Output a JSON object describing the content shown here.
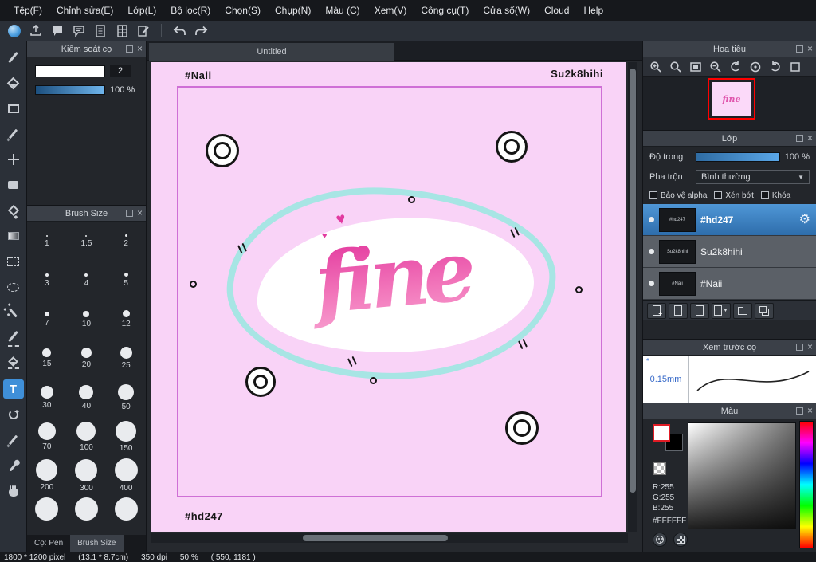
{
  "menubar": {
    "items": [
      "Tệp(F)",
      "Chỉnh sửa(E)",
      "Lớp(L)",
      "Bộ lọc(R)",
      "Chọn(S)",
      "Chụp(N)",
      "Màu (C)",
      "Xem(V)",
      "Công cụ(T)",
      "Cửa sổ(W)",
      "Cloud",
      "Help"
    ]
  },
  "canvas": {
    "tab_title": "Untitled",
    "top_left": "#Naii",
    "top_right": "Su2k8hihi",
    "bottom_left": "#hd247",
    "word": "fine"
  },
  "left": {
    "brush_control": {
      "title": "Kiểm soát cọ",
      "width_value": "2",
      "opacity_value": "100 %"
    },
    "brush_size": {
      "title": "Brush Size",
      "sizes": [
        "1",
        "1.5",
        "2",
        "3",
        "4",
        "5",
        "7",
        "10",
        "12",
        "15",
        "20",
        "25",
        "30",
        "40",
        "50",
        "70",
        "100",
        "150",
        "200",
        "300",
        "400",
        "",
        "",
        ""
      ]
    },
    "tabs": {
      "pen": "Cọ: Pen",
      "size": "Brush Size"
    }
  },
  "right": {
    "navigator": {
      "title": "Hoa tiêu"
    },
    "layers": {
      "title": "Lớp",
      "opacity_label": "Độ trong",
      "opacity_value": "100 %",
      "blend_label": "Pha trộn",
      "blend_value": "Bình thường",
      "checkboxes": [
        "Bảo vệ alpha",
        "Xén bớt",
        "Khóa"
      ],
      "items": [
        {
          "name": "#hd247",
          "selected": true
        },
        {
          "name": "Su2k8hihi",
          "selected": false
        },
        {
          "name": "#Naii",
          "selected": false
        }
      ]
    },
    "brush_preview": {
      "title": "Xem trước cọ",
      "size": "0.15mm"
    },
    "color": {
      "title": "Màu",
      "r": "R:255",
      "g": "G:255",
      "b": "B:255",
      "hex": "#FFFFFF"
    }
  },
  "statusbar": {
    "dimensions": "1800 * 1200 pixel",
    "cm": "(13.1 * 8.7cm)",
    "dpi": "350 dpi",
    "zoom": "50 %",
    "coords": "( 550, 1181 )"
  },
  "icons": {
    "close": "×",
    "dropdown": "▼",
    "gear": "⚙",
    "heart": "♥",
    "asterisk": "*",
    "plus": "+",
    "text_tool": "T"
  },
  "colors": {
    "accent_blue": "#3f8fd8",
    "canvas_pink": "#f9d3f7",
    "canvas_border_pink": "#cf6fd6",
    "artwork_pink": "#e02c98",
    "artwork_cyan": "#a7e5e4",
    "selected_layer_blue": "#3c7fc0",
    "navigator_frame_red": "#ff0000",
    "foreground_color": "#FFFFFF"
  }
}
